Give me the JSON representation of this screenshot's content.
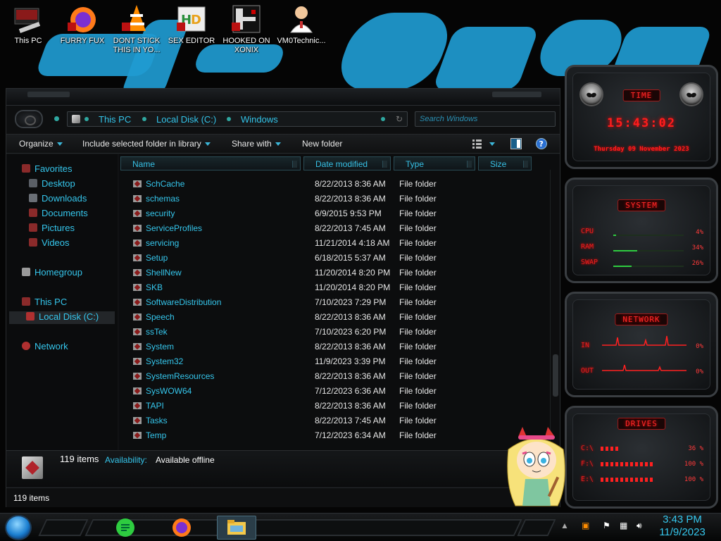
{
  "desktop": {
    "icons": [
      {
        "name": "this-pc",
        "label": "This PC"
      },
      {
        "name": "furry-fux",
        "label": "FURRY FUX"
      },
      {
        "name": "dont-stick",
        "label": "DONT STICK\nTHIS IN YO..."
      },
      {
        "name": "sex-editor",
        "label": "SEX EDITOR"
      },
      {
        "name": "hooked-on-xonix",
        "label": "HOOKED ON\nXONIX"
      },
      {
        "name": "vm0technic",
        "label": "VM0Technic..."
      }
    ]
  },
  "explorer": {
    "breadcrumb": [
      "This PC",
      "Local Disk (C:)",
      "Windows"
    ],
    "search_placeholder": "Search Windows",
    "toolbar": {
      "organize": "Organize",
      "include": "Include selected folder in library",
      "share": "Share with",
      "new_folder": "New folder"
    },
    "nav": {
      "favorites": "Favorites",
      "desktop": "Desktop",
      "downloads": "Downloads",
      "documents": "Documents",
      "pictures": "Pictures",
      "videos": "Videos",
      "homegroup": "Homegroup",
      "this_pc": "This PC",
      "local_disk": "Local Disk (C:)",
      "network": "Network"
    },
    "columns": {
      "name": "Name",
      "date": "Date modified",
      "type": "Type",
      "size": "Size"
    },
    "rows": [
      {
        "name": "SchCache",
        "date": "8/22/2013 8:36 AM",
        "type": "File folder"
      },
      {
        "name": "schemas",
        "date": "8/22/2013 8:36 AM",
        "type": "File folder"
      },
      {
        "name": "security",
        "date": "6/9/2015 9:53 PM",
        "type": "File folder"
      },
      {
        "name": "ServiceProfiles",
        "date": "8/22/2013 7:45 AM",
        "type": "File folder"
      },
      {
        "name": "servicing",
        "date": "11/21/2014 4:18 AM",
        "type": "File folder"
      },
      {
        "name": "Setup",
        "date": "6/18/2015 5:37 AM",
        "type": "File folder"
      },
      {
        "name": "ShellNew",
        "date": "11/20/2014 8:20 PM",
        "type": "File folder"
      },
      {
        "name": "SKB",
        "date": "11/20/2014 8:20 PM",
        "type": "File folder"
      },
      {
        "name": "SoftwareDistribution",
        "date": "7/10/2023 7:29 PM",
        "type": "File folder"
      },
      {
        "name": "Speech",
        "date": "8/22/2013 8:36 AM",
        "type": "File folder"
      },
      {
        "name": "ssTek",
        "date": "7/10/2023 6:20 PM",
        "type": "File folder"
      },
      {
        "name": "System",
        "date": "8/22/2013 8:36 AM",
        "type": "File folder"
      },
      {
        "name": "System32",
        "date": "11/9/2023 3:39 PM",
        "type": "File folder"
      },
      {
        "name": "SystemResources",
        "date": "8/22/2013 8:36 AM",
        "type": "File folder"
      },
      {
        "name": "SysWOW64",
        "date": "7/12/2023 6:36 AM",
        "type": "File folder"
      },
      {
        "name": "TAPI",
        "date": "8/22/2013 8:36 AM",
        "type": "File folder"
      },
      {
        "name": "Tasks",
        "date": "8/22/2013 7:45 AM",
        "type": "File folder"
      },
      {
        "name": "Temp",
        "date": "7/12/2023 6:34 AM",
        "type": "File folder"
      }
    ],
    "details": {
      "count": "119 items",
      "availability_label": "Availability:",
      "availability_value": "Available offline"
    },
    "status": "119 items"
  },
  "gadgets": {
    "time": {
      "title": "TIME",
      "clock": "15:43:02",
      "date": "Thursday 09 November 2023"
    },
    "system": {
      "title": "SYSTEM",
      "items": [
        {
          "label": "CPU",
          "value": "4%",
          "level": 0.04
        },
        {
          "label": "RAM",
          "value": "34%",
          "level": 0.34
        },
        {
          "label": "SWAP",
          "value": "26%",
          "level": 0.26
        }
      ]
    },
    "network": {
      "title": "NETWORK",
      "in_label": "IN",
      "in_value": "0%",
      "out_label": "OUT",
      "out_value": "0%"
    },
    "drives": {
      "title": "DRIVES",
      "items": [
        {
          "label": "C:\\",
          "value": "36 %"
        },
        {
          "label": "F:\\",
          "value": "100 %"
        },
        {
          "label": "E:\\",
          "value": "100 %"
        }
      ]
    }
  },
  "taskbar": {
    "time": "3:43 PM",
    "date": "11/9/2023"
  },
  "colors": {
    "accent_cyan": "#35c6ec",
    "gadget_red": "#ff1d1d",
    "wallpaper_blue": "#1f9bd1"
  }
}
